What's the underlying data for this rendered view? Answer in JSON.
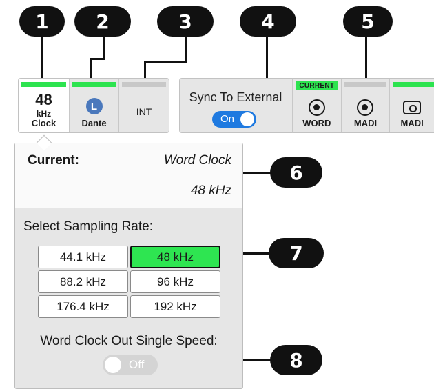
{
  "callouts": [
    "1",
    "2",
    "3",
    "4",
    "5",
    "6",
    "7",
    "8"
  ],
  "colors": {
    "active_bar": "#2de34f",
    "toggle_on": "#1f7ae0",
    "dante_icon": "#4a78bc"
  },
  "tiles": {
    "clock": {
      "rate": "48",
      "unit": "kHz",
      "caption": "Clock"
    },
    "dante": {
      "icon_letter": "L",
      "caption": "Dante"
    },
    "int": {
      "label": "INT"
    }
  },
  "sync": {
    "label": "Sync To External",
    "toggle": "On"
  },
  "inputs": [
    {
      "tag": "Current",
      "caption": "WORD",
      "icon": "bnc-connector-icon"
    },
    {
      "caption": "MADI",
      "icon": "bnc-connector-icon"
    },
    {
      "caption": "MADI",
      "icon": "optical-connector-icon"
    }
  ],
  "popover": {
    "current_label": "Current:",
    "current_source": "Word Clock",
    "current_rate": "48 kHz",
    "select_title": "Select Sampling Rate:",
    "rates": [
      "44.1 kHz",
      "48 kHz",
      "88.2 kHz",
      "96 kHz",
      "176.4 kHz",
      "192 kHz"
    ],
    "selected_rate": "48 kHz",
    "wc_title": "Word Clock Out Single Speed:",
    "wc_toggle": "Off"
  }
}
